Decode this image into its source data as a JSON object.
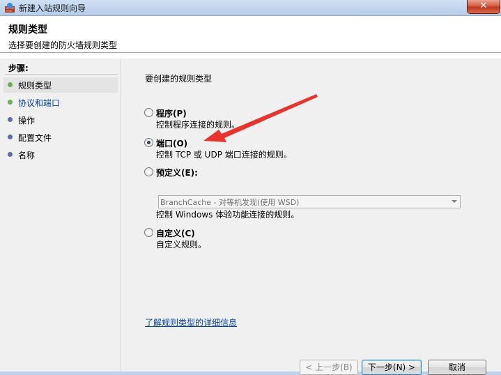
{
  "window": {
    "title": "新建入站规则向导"
  },
  "header": {
    "title": "规则类型",
    "subtitle": "选择要创建的防火墙规则类型"
  },
  "sidebar": {
    "steps_label": "步骤:",
    "steps": [
      {
        "label": "规则类型",
        "dot": "#6ab04c",
        "active": true
      },
      {
        "label": "协议和端口",
        "dot": "#6ab04c",
        "link": true
      },
      {
        "label": "操作",
        "dot": "#5a6bb5"
      },
      {
        "label": "配置文件",
        "dot": "#5a6bb5"
      },
      {
        "label": "名称",
        "dot": "#5a6bb5"
      }
    ]
  },
  "content": {
    "heading": "要创建的规则类型",
    "options": [
      {
        "label": "程序(P)",
        "desc": "控制程序连接的规则。",
        "checked": false
      },
      {
        "label": "端口(O)",
        "desc": "控制 TCP 或 UDP 端口连接的规则。",
        "checked": true
      },
      {
        "label": "预定义(E):",
        "desc": "控制 Windows 体验功能连接的规则。",
        "checked": false
      },
      {
        "label": "自定义(C)",
        "desc": "自定义规则。",
        "checked": false
      }
    ],
    "predefined_value": "BranchCache - 对等机发现(使用 WSD)",
    "learn_more": "了解规则类型的详细信息"
  },
  "buttons": {
    "back": "< 上一步(B)",
    "next": "下一步(N) >",
    "cancel": "取消"
  },
  "colors": {
    "annotation_arrow": "#e8342c",
    "link": "#0645ad"
  }
}
